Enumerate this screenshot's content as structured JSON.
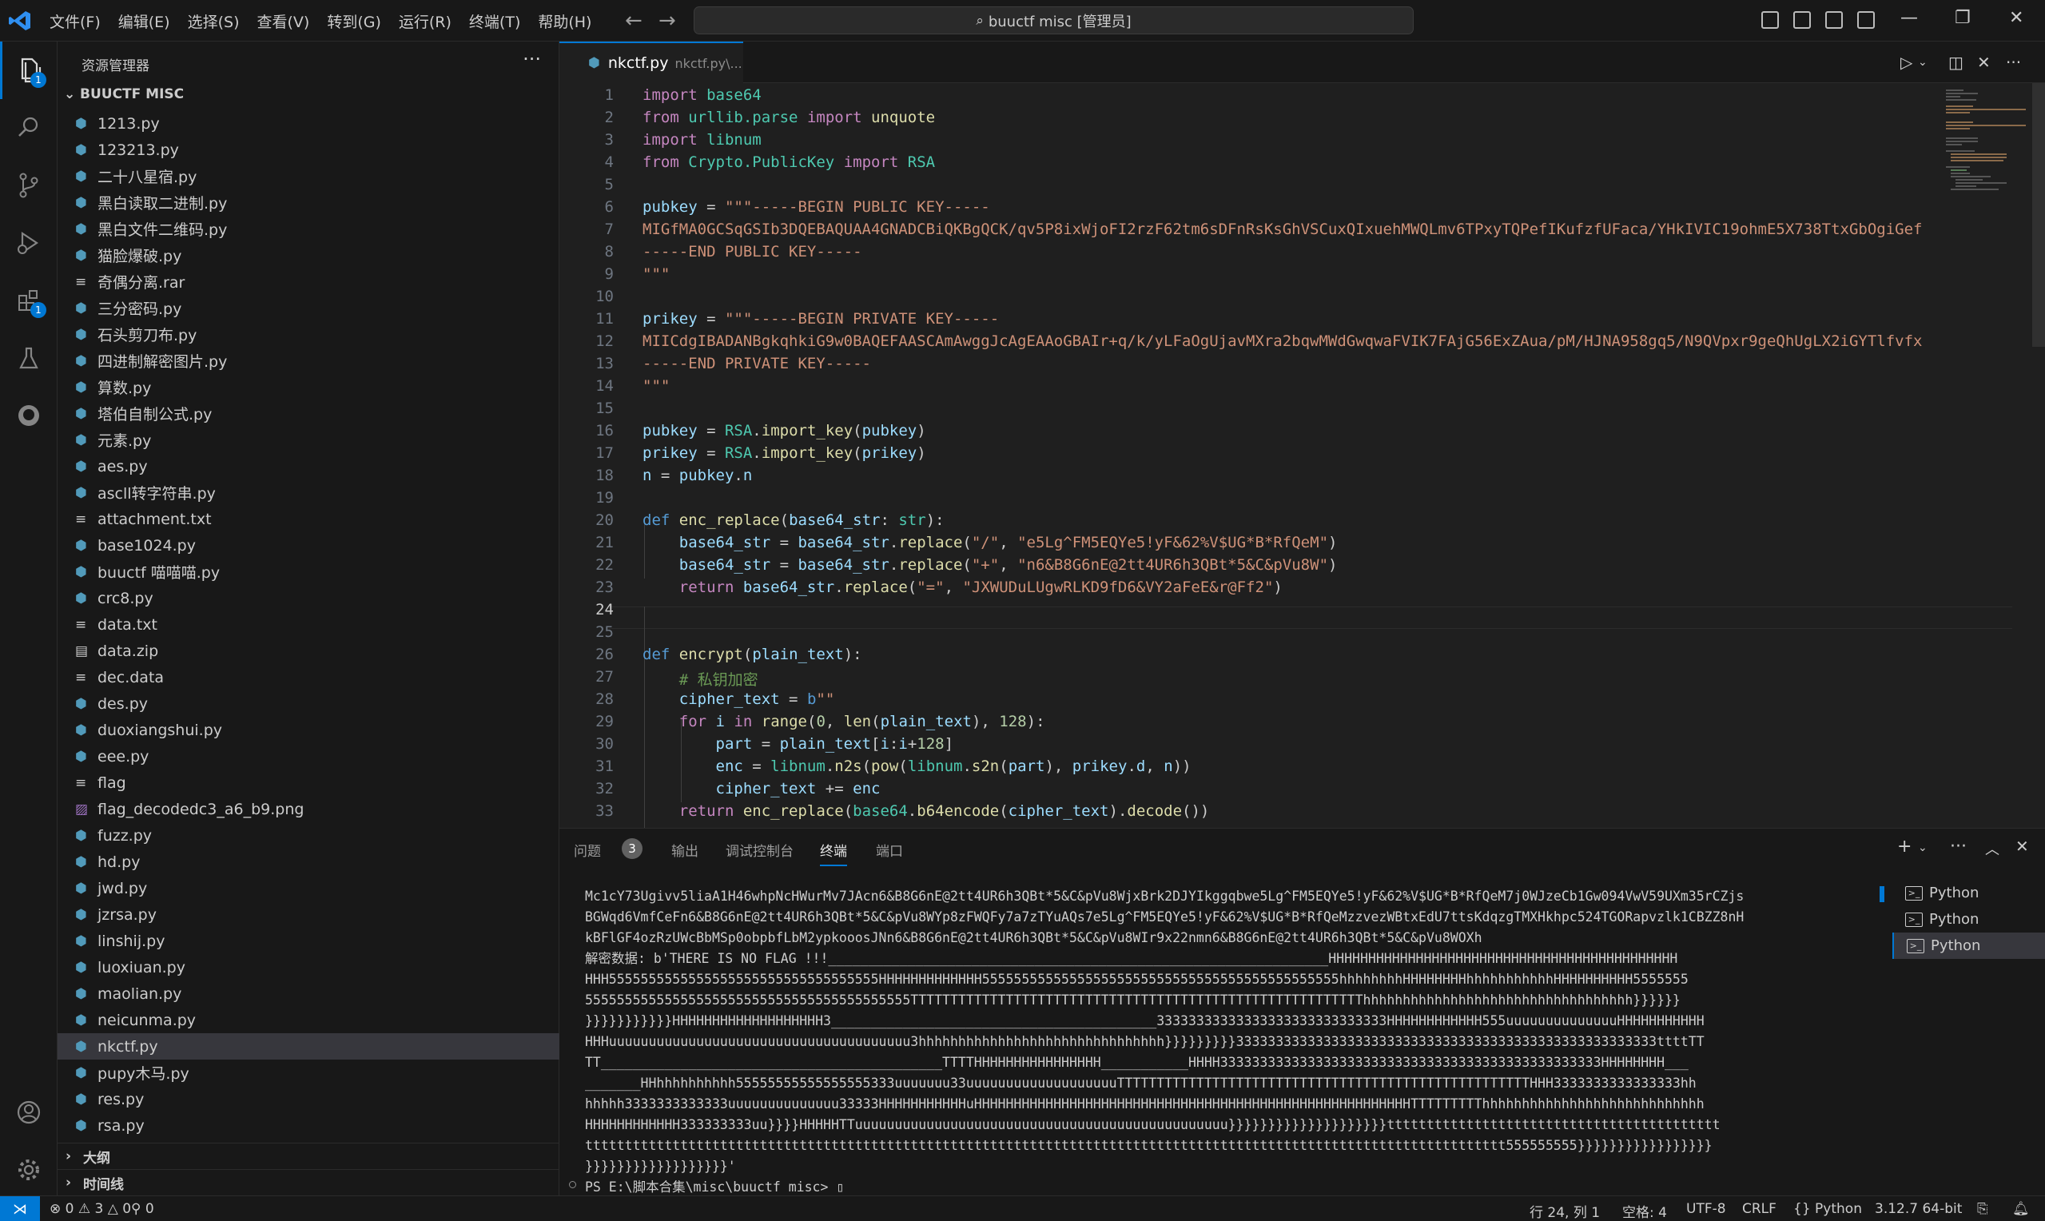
{
  "titlebar": {
    "menu": [
      "文件(F)",
      "编辑(E)",
      "选择(S)",
      "查看(V)",
      "转到(G)",
      "运行(R)",
      "终端(T)",
      "帮助(H)"
    ],
    "command_center": "buuctf misc [管理员]"
  },
  "activitybar": {
    "explorer_badge": "1",
    "extensions_badge": "1"
  },
  "sidebar": {
    "title": "资源管理器",
    "root": "BUUCTF MISC",
    "files": [
      {
        "name": "1213.py",
        "type": "py"
      },
      {
        "name": "123213.py",
        "type": "py"
      },
      {
        "name": "二十八星宿.py",
        "type": "py"
      },
      {
        "name": "黑白读取二进制.py",
        "type": "py"
      },
      {
        "name": "黑白文件二维码.py",
        "type": "py"
      },
      {
        "name": "猫脸爆破.py",
        "type": "py"
      },
      {
        "name": "奇偶分离.rar",
        "type": "txt"
      },
      {
        "name": "三分密码.py",
        "type": "py"
      },
      {
        "name": "石头剪刀布.py",
        "type": "py"
      },
      {
        "name": "四进制解密图片.py",
        "type": "py"
      },
      {
        "name": "算数.py",
        "type": "py"
      },
      {
        "name": "塔伯自制公式.py",
        "type": "py"
      },
      {
        "name": "元素.py",
        "type": "py"
      },
      {
        "name": "aes.py",
        "type": "py"
      },
      {
        "name": "ascll转字符串.py",
        "type": "py"
      },
      {
        "name": "attachment.txt",
        "type": "txt"
      },
      {
        "name": "base1024.py",
        "type": "py"
      },
      {
        "name": "buuctf 喵喵喵.py",
        "type": "py"
      },
      {
        "name": "crc8.py",
        "type": "py"
      },
      {
        "name": "data.txt",
        "type": "txt"
      },
      {
        "name": "data.zip",
        "type": "zip"
      },
      {
        "name": "dec.data",
        "type": "txt"
      },
      {
        "name": "des.py",
        "type": "py"
      },
      {
        "name": "duoxiangshui.py",
        "type": "py"
      },
      {
        "name": "eee.py",
        "type": "py"
      },
      {
        "name": "flag",
        "type": "txt"
      },
      {
        "name": "flag_decodedc3_a6_b9.png",
        "type": "img"
      },
      {
        "name": "fuzz.py",
        "type": "py"
      },
      {
        "name": "hd.py",
        "type": "py"
      },
      {
        "name": "jwd.py",
        "type": "py"
      },
      {
        "name": "jzrsa.py",
        "type": "py"
      },
      {
        "name": "linshij.py",
        "type": "py"
      },
      {
        "name": "luoxiuan.py",
        "type": "py"
      },
      {
        "name": "maolian.py",
        "type": "py"
      },
      {
        "name": "neicunma.py",
        "type": "py"
      },
      {
        "name": "nkctf.py",
        "type": "py",
        "selected": true
      },
      {
        "name": "pupy木马.py",
        "type": "py"
      },
      {
        "name": "res.py",
        "type": "py"
      },
      {
        "name": "rsa.py",
        "type": "py"
      }
    ],
    "outline": "大纲",
    "timeline": "时间线"
  },
  "editor": {
    "tab_name": "nkctf.py",
    "tab_desc": "nkctf.py\\...",
    "current_line": 24
  },
  "panel": {
    "tabs": [
      "问题",
      "输出",
      "调试控制台",
      "终端",
      "端口"
    ],
    "problems_badge": "3",
    "terminals": [
      "Python",
      "Python",
      "Python"
    ],
    "output": [
      "Mc1cY73Ugivv5liaA1H46whpNcHWurMv7JAcn6&B8G6nE@2tt4UR6h3QBt*5&C&pVu8WjxBrk2DJYIkggqbwe5Lg^FM5EQYe5!yF&62%V$UG*B*RfQeM7j0WJzeCb1Gw094VwV59UXm35rCZjs",
      "BGWqd6VmfCeFn6&B8G6nE@2tt4UR6h3QBt*5&C&pVu8WYp8zFWQFy7a7zTYuAQs7e5Lg^FM5EQYe5!yF&62%V$UG*B*RfQeMzzvezWBtxEdU7ttsKdqzgTMXHkhpc524TGORapvzlk1CBZZ8nH",
      "kBFlGF4ozRzUWcBbMSp0obpbfLbM2ypkooosJNn6&B8G6nE@2tt4UR6h3QBt*5&C&pVu8WIr9x22nmn6&B8G6nE@2tt4UR6h3QBt*5&C&pVu8WOXh",
      "解密数据: b'THERE IS NO FLAG !!!_______________________________________________________________HHHHHHHHHHHHHHHHHHHHHHHHHHHHHHHHHHHHHHHHHHHH",
      "HHH5555555555555555555555555555555555HHHHHHHHHHHHH555555555555555555555555555555555555555555555hhhhhhhhHHHHHHHHhhhhhhhhhhhHHHHHHHHHH5555555",
      "55555555555555555555555555555555555555555TTTTTTTTTTTTTTTTTTTTTTTTTTTTTTTTTTTTTTTTTTTTTTTTTTTTTTTTThhhhhhhhhhhhhhhhhhhhhhhhhhhhhhhhhh}}}}}}",
      "}}}}}}}}}}}HHHHHHHHHHHHHHHHHHH3_________________________________________33333333333333333333333333333HHHHHHHHHHHH555uuuuuuuuuuuuuuHHHHHHHHHHH",
      "HHHuuuuuuuuuuuuuuuuuuuuuuuuuuuuuuuuuuuuuu3hhhhhhhhhhhhhhhhhhhhhhhhhhhhhhh}}}}}}}}}33333333333333333333333333333333333333333333333333333ttttTT",
      "TT___________________________________________TTTTHHHHHHHHHHHHHHHH___________HHHH333333333333333333333333333333333333333333333333HHHHHHHH___",
      "_______HHhhhhhhhhhh55555555555555555333uuuuuuu33uuuuuuuuuuuuuuuuuuuTTTTTTTTTTTTTTTTTTTTTTTTTTTTTTTTTTTTTTTTTTTTTTTTTTTTHHH3333333333333333hh",
      "hhhhh3333333333333uuuuuuuuuuuuuu33333HHHHHHHHHHHuHHHHHHHHHHHHHHHHHHHHHHHHHHHHHHHHHHHHHHHHHHHHHHHHHHHHHHHTTTTTTTTThhhhhhhhhhhhhhhhhhhhhhhhhhhh",
      "HHHHHHHHHHHH333333333uu}}}}HHHHHTTuuuuuuuuuuuuuuuuuuuuuuuuuuuuuuuuuuuuuuuuuuuuuuu}}}}}}}}}}}}}}}}}}}}tttttttttttttttttttttttttttttttttttttttttt",
      "tttttttttttttttttttttttttttttttttttttttttttttttttttttttttttttttttttttttttttttttttttttttttttttttttttttttttttttttttttt555555555}}}}}}}}}}}}}}}}}",
      "}}}}}}}}}}}}}}}}}}'",
      "PS E:\\脚本合集\\misc\\buuctf misc> ▯"
    ]
  },
  "statusbar": {
    "errors": "0",
    "warnings": "3",
    "infos": "0",
    "ports": "0",
    "position": "行 24, 列 1",
    "spaces": "空格: 4",
    "encoding": "UTF-8",
    "eol": "CRLF",
    "language": "Python",
    "interpreter": "3.12.7 64-bit"
  }
}
